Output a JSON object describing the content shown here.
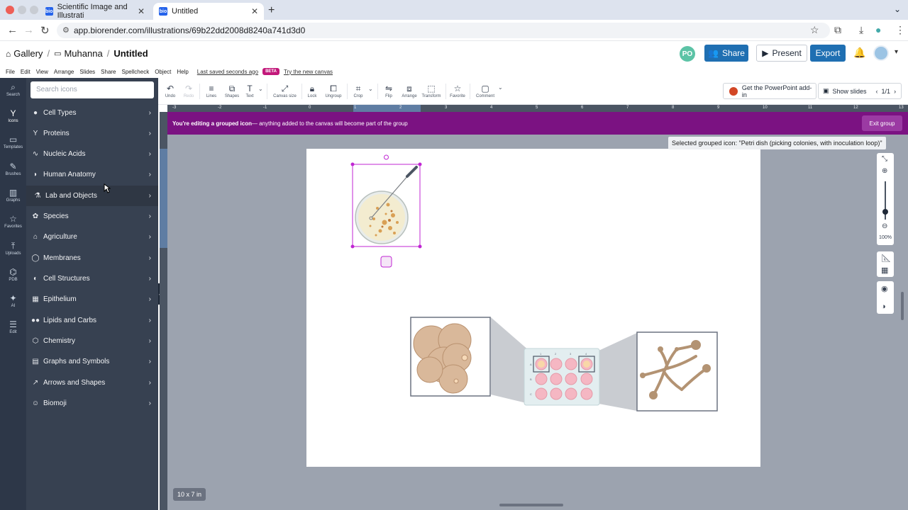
{
  "browser": {
    "tabs": [
      {
        "title": "Scientific Image and Illustrati",
        "favicon": "bio",
        "active": false
      },
      {
        "title": "Untitled",
        "favicon": "bio",
        "active": true
      }
    ],
    "url": "app.biorender.com/illustrations/69b22dd2008d8240a741d3d0"
  },
  "header": {
    "breadcrumb": {
      "home": "Gallery",
      "folder": "Muhanna",
      "current": "Untitled"
    },
    "collaborator_initials": "PO",
    "share_label": "Share",
    "present_label": "Present",
    "export_label": "Export"
  },
  "menubar": {
    "items": [
      "File",
      "Edit",
      "View",
      "Arrange",
      "Slides",
      "Share",
      "Spellcheck",
      "Object",
      "Help"
    ],
    "last_saved": "Last saved seconds ago",
    "beta_badge": "BETA",
    "try_new": "Try the new canvas"
  },
  "rail": {
    "items": [
      {
        "label": "Search",
        "icon": "search-icon"
      },
      {
        "label": "Icons",
        "icon": "icons-icon",
        "active": true
      },
      {
        "label": "Templates",
        "icon": "templates-icon"
      },
      {
        "label": "Brushes",
        "icon": "brush-icon"
      },
      {
        "label": "Graphs",
        "icon": "graph-icon"
      },
      {
        "label": "Favorites",
        "icon": "star-icon"
      },
      {
        "label": "Uploads",
        "icon": "upload-icon"
      },
      {
        "label": "PDB",
        "icon": "pdb-icon"
      },
      {
        "label": "AI",
        "icon": "ai-icon"
      },
      {
        "label": "Edit",
        "icon": "sliders-icon"
      }
    ]
  },
  "panel": {
    "search_placeholder": "Search icons",
    "categories": [
      {
        "label": "Cell Types",
        "icon": "cell-icon"
      },
      {
        "label": "Proteins",
        "icon": "protein-icon"
      },
      {
        "label": "Nucleic Acids",
        "icon": "dna-icon"
      },
      {
        "label": "Human Anatomy",
        "icon": "anatomy-icon"
      },
      {
        "label": "Lab and Objects",
        "icon": "flask-icon"
      },
      {
        "label": "Species",
        "icon": "species-icon"
      },
      {
        "label": "Agriculture",
        "icon": "agriculture-icon"
      },
      {
        "label": "Membranes",
        "icon": "membrane-icon"
      },
      {
        "label": "Cell Structures",
        "icon": "cell-structure-icon"
      },
      {
        "label": "Epithelium",
        "icon": "epithelium-icon"
      },
      {
        "label": "Lipids and Carbs",
        "icon": "lipid-icon"
      },
      {
        "label": "Chemistry",
        "icon": "chemistry-icon"
      },
      {
        "label": "Graphs and Symbols",
        "icon": "graphs-symbols-icon"
      },
      {
        "label": "Arrows and Shapes",
        "icon": "arrow-icon"
      },
      {
        "label": "Biomoji",
        "icon": "biomoji-icon"
      }
    ]
  },
  "toolbar": {
    "tools": [
      {
        "label": "Undo",
        "enabled": true
      },
      {
        "label": "Redo",
        "enabled": false
      },
      {
        "label": "Lines",
        "enabled": true
      },
      {
        "label": "Shapes",
        "enabled": true
      },
      {
        "label": "Text",
        "enabled": true
      },
      {
        "label": "Canvas size",
        "enabled": true
      },
      {
        "label": "Lock",
        "enabled": true
      },
      {
        "label": "Ungroup",
        "enabled": true
      },
      {
        "label": "Crop",
        "enabled": true
      },
      {
        "label": "Flip",
        "enabled": true
      },
      {
        "label": "Arrange",
        "enabled": true
      },
      {
        "label": "Transform",
        "enabled": true
      },
      {
        "label": "Favorite",
        "enabled": true
      },
      {
        "label": "Comment",
        "enabled": true
      }
    ],
    "ppt_addin": "Get the PowerPoint add-in",
    "show_slides": "Show slides",
    "slide_page": "1/1"
  },
  "ruler": {
    "h_ticks": [
      "-3",
      "-2",
      "-1",
      "0",
      "1",
      "2",
      "3",
      "4",
      "5",
      "6",
      "7",
      "8",
      "9",
      "10",
      "11",
      "12",
      "13"
    ]
  },
  "banner": {
    "bold": "You're editing a grouped icon",
    "text": " — anything added to the canvas will become part of the group",
    "exit_label": "Exit group"
  },
  "canvas": {
    "tooltip": "Selected grouped icon: \"Petri dish (picking colonies, with inoculation loop)\"",
    "size_label": "10 x 7 in",
    "zoom": "100%",
    "plate_rows": [
      "A",
      "B",
      "C"
    ],
    "plate_cols": [
      "1",
      "2",
      "3",
      "4"
    ]
  },
  "colors": {
    "brand_blue": "#1f6fb2",
    "banner_purple": "#7b1282",
    "beta_magenta": "#c2187a",
    "selection": "#c026d3"
  }
}
